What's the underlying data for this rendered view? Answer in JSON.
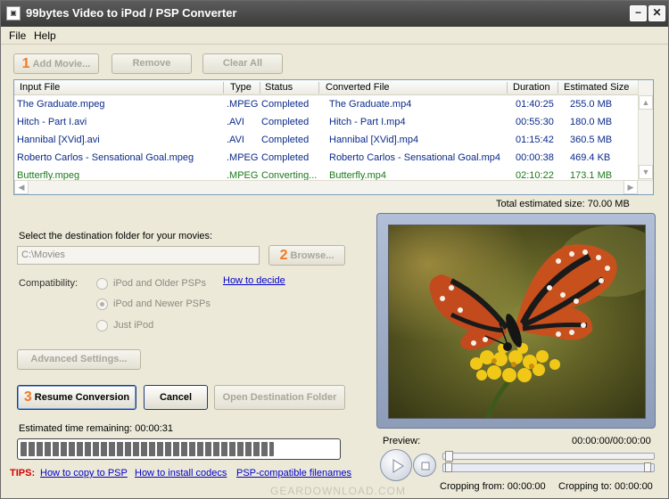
{
  "window": {
    "title": "99bytes Video to iPod / PSP Converter",
    "app_icon": "app-icon",
    "minimize_glyph": "−",
    "close_glyph": "✕"
  },
  "menu": [
    "File",
    "Help"
  ],
  "toolbar": {
    "add_num": "1",
    "add_label": "Add Movie...",
    "remove_label": "Remove",
    "clear_label": "Clear All"
  },
  "table": {
    "columns": [
      "Input File",
      "Type",
      "Status",
      "Converted File",
      "Duration",
      "Estimated Size"
    ],
    "rows": [
      [
        "The Graduate.mpeg",
        ".MPEG",
        "Completed",
        "The Graduate.mp4",
        "01:40:25",
        "255.0 MB"
      ],
      [
        "Hitch - Part I.avi",
        ".AVI",
        "Completed",
        "Hitch - Part I.mp4",
        "00:55:30",
        "180.0 MB"
      ],
      [
        "Hannibal [XVid].avi",
        ".AVI",
        "Completed",
        "Hannibal [XVid].mp4",
        "01:15:42",
        "360.5 MB"
      ],
      [
        "Roberto Carlos - Sensational Goal.mpeg",
        ".MPEG",
        "Completed",
        "Roberto Carlos - Sensational Goal.mp4",
        "00:00:38",
        "469.4 KB"
      ],
      [
        "Butterfly.mpeg",
        ".MPEG",
        "Converting...",
        "Butterfly.mp4",
        "02:10:22",
        "173.1 MB"
      ]
    ]
  },
  "total_size": "Total estimated size:  70.00 MB",
  "destination": {
    "label": "Select the destination folder for your movies:",
    "value": "C:\\Movies",
    "browse_num": "2",
    "browse_label": "Browse..."
  },
  "compatibility": {
    "label": "Compatibility:",
    "options": [
      "iPod and Older PSPs",
      "iPod and Newer PSPs",
      "Just iPod"
    ],
    "selected_index": 1,
    "how_link": "How to decide"
  },
  "advanced_label": "Advanced Settings...",
  "actions": {
    "resume_num": "3",
    "resume_label": "Resume Conversion",
    "cancel_label": "Cancel",
    "open_label": "Open Destination Folder"
  },
  "time_remaining": "Estimated time remaining:  00:00:31",
  "progress_fraction": 0.8,
  "preview": {
    "label": "Preview:",
    "time": "00:00:00/00:00:00",
    "cropping_from": "Cropping from: 00:00:00",
    "cropping_to": "Cropping to: 00:00:00"
  },
  "tips": {
    "label": "TIPS:",
    "links": [
      "How to copy to PSP",
      "How to install codecs",
      "PSP-compatible filenames"
    ]
  },
  "watermark": "GEARDOWNLOAD.COM",
  "colors": {
    "accent_number": "#f07b25",
    "link": "#0000cc",
    "completed_row": "#0a2a8a",
    "converting_row": "#1b7a1b"
  }
}
